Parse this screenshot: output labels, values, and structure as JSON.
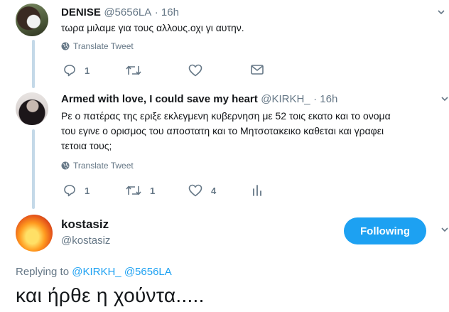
{
  "tweets": [
    {
      "name": "DENISE",
      "handle": "@5656LA",
      "time": "· 16h",
      "text_lines": [
        "τωρα μιλαμε για τους αλλους.οχι γι αυτην."
      ],
      "translate_label": "Translate Tweet",
      "replies": "1",
      "retweets": "",
      "likes": ""
    },
    {
      "name": "Armed with love, I could save my heart",
      "handle": "@KIRKH_",
      "time": "· 16h",
      "text_lines": [
        "Ρε ο πατέρας της εριξε εκλεγμενη κυβερνηση με 52 τοις εκατο και το ονομα",
        "του εγινε ο ορισμος του αποστατη και το Μητσοτακεικο καθεται και γραφει",
        "τετοια τους;"
      ],
      "translate_label": "Translate Tweet",
      "replies": "1",
      "retweets": "1",
      "likes": "4"
    }
  ],
  "main_tweet": {
    "name": "kostasiz",
    "handle": "@kostasiz",
    "follow_label": "Following",
    "replying_prefix": "Replying to",
    "mentions": [
      "@KIRKH_",
      "@5656LA"
    ],
    "text": "και ήρθε η χούντα....."
  },
  "colors": {
    "accent": "#1da1f2",
    "secondary_text": "#657786",
    "thread_line": "#c4d9e8"
  },
  "icons": [
    "reply-icon",
    "retweet-icon",
    "like-icon",
    "dm-icon",
    "analytics-icon",
    "globe-icon",
    "chevron-down-icon"
  ]
}
